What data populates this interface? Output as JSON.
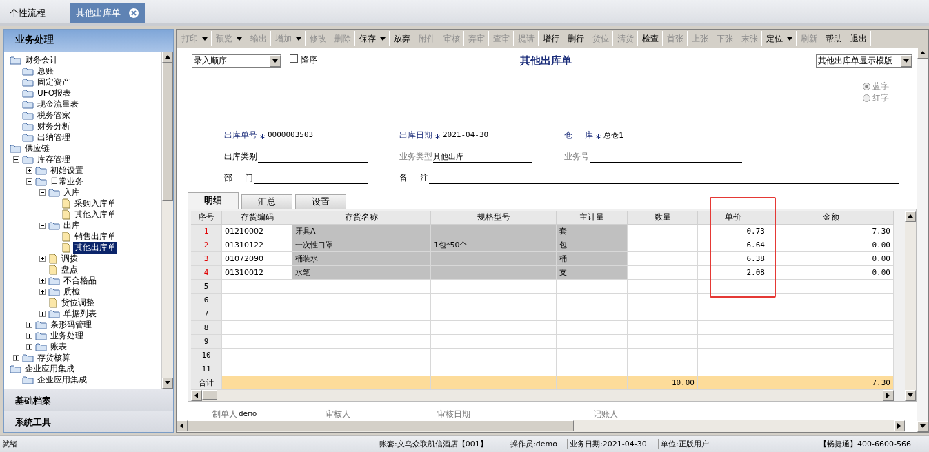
{
  "tabs": [
    {
      "label": "个性流程",
      "selected": false,
      "closable": false
    },
    {
      "label": "其他出库单",
      "selected": true,
      "closable": true
    }
  ],
  "nav": {
    "title": "业务处理",
    "tree": [
      {
        "label": "财务会计",
        "kind": "folder",
        "children": [
          {
            "label": "总账",
            "kind": "folder"
          },
          {
            "label": "固定资产",
            "kind": "folder"
          },
          {
            "label": "UFO报表",
            "kind": "folder"
          },
          {
            "label": "现金流量表",
            "kind": "folder"
          },
          {
            "label": "税务管家",
            "kind": "folder"
          },
          {
            "label": "财务分析",
            "kind": "folder"
          },
          {
            "label": "出纳管理",
            "kind": "folder"
          }
        ]
      },
      {
        "label": "供应链",
        "kind": "folder",
        "children": [
          {
            "label": "库存管理",
            "kind": "folder",
            "expanded": true,
            "children": [
              {
                "label": "初始设置",
                "kind": "folder",
                "expanded": false
              },
              {
                "label": "日常业务",
                "kind": "folder",
                "expanded": true,
                "children": [
                  {
                    "label": "入库",
                    "kind": "folder",
                    "expanded": true,
                    "children": [
                      {
                        "label": "采购入库单",
                        "kind": "document",
                        "selected": false
                      },
                      {
                        "label": "其他入库单",
                        "kind": "document",
                        "selected": false
                      }
                    ]
                  },
                  {
                    "label": "出库",
                    "kind": "folder",
                    "expanded": true,
                    "children": [
                      {
                        "label": "销售出库单",
                        "kind": "document",
                        "selected": false
                      },
                      {
                        "label": "其他出库单",
                        "kind": "document",
                        "selected": true
                      }
                    ]
                  },
                  {
                    "label": "调拨",
                    "kind": "document",
                    "expanded": false
                  },
                  {
                    "label": "盘点",
                    "kind": "document"
                  },
                  {
                    "label": "不合格品",
                    "kind": "folder",
                    "expanded": false
                  },
                  {
                    "label": "质检",
                    "kind": "folder",
                    "expanded": false
                  },
                  {
                    "label": "货位调整",
                    "kind": "document"
                  },
                  {
                    "label": "单据列表",
                    "kind": "folder",
                    "expanded": false
                  }
                ]
              },
              {
                "label": "条形码管理",
                "kind": "folder",
                "expanded": false
              },
              {
                "label": "业务处理",
                "kind": "folder",
                "expanded": false
              },
              {
                "label": "账表",
                "kind": "folder",
                "expanded": false
              }
            ]
          },
          {
            "label": "存货核算",
            "kind": "folder",
            "expanded": false
          }
        ]
      },
      {
        "label": "企业应用集成",
        "kind": "folder",
        "children": [
          {
            "label": "企业应用集成",
            "kind": "folder"
          }
        ]
      }
    ],
    "sections": [
      "基础档案",
      "系统工具"
    ]
  },
  "toolbar": [
    {
      "label": "打印",
      "disabled": true,
      "dropdown": true
    },
    {
      "label": "预览",
      "disabled": true,
      "dropdown": true
    },
    {
      "label": "输出",
      "disabled": true,
      "dropdown": false
    },
    {
      "label": "增加",
      "disabled": true,
      "dropdown": true
    },
    {
      "label": "修改",
      "disabled": true,
      "dropdown": false
    },
    {
      "label": "删除",
      "disabled": true,
      "dropdown": false
    },
    {
      "label": "保存",
      "disabled": false,
      "dropdown": true
    },
    {
      "label": "放弃",
      "disabled": false,
      "dropdown": false
    },
    {
      "label": "附件",
      "disabled": true,
      "dropdown": false
    },
    {
      "label": "审核",
      "disabled": true,
      "dropdown": false
    },
    {
      "label": "弃审",
      "disabled": true,
      "dropdown": false
    },
    {
      "label": "查审",
      "disabled": true,
      "dropdown": false
    },
    {
      "label": "提请",
      "disabled": true,
      "dropdown": false
    },
    {
      "label": "增行",
      "disabled": false,
      "dropdown": false
    },
    {
      "label": "删行",
      "disabled": false,
      "dropdown": false
    },
    {
      "label": "货位",
      "disabled": true,
      "dropdown": false
    },
    {
      "label": "清货",
      "disabled": true,
      "dropdown": false
    },
    {
      "label": "检查",
      "disabled": false,
      "dropdown": false
    },
    {
      "label": "首张",
      "disabled": true,
      "dropdown": false
    },
    {
      "label": "上张",
      "disabled": true,
      "dropdown": false
    },
    {
      "label": "下张",
      "disabled": true,
      "dropdown": false
    },
    {
      "label": "末张",
      "disabled": true,
      "dropdown": false
    },
    {
      "label": "定位",
      "disabled": false,
      "dropdown": true
    },
    {
      "label": "刷新",
      "disabled": true,
      "dropdown": false
    },
    {
      "label": "帮助",
      "disabled": false,
      "dropdown": false
    },
    {
      "label": "退出",
      "disabled": false,
      "dropdown": false
    }
  ],
  "form": {
    "sort_select": {
      "value": "录入顺序"
    },
    "descending": {
      "label": "降序",
      "checked": false
    },
    "title": "其他出库单",
    "template_select": {
      "value": "其他出库单显示模版"
    },
    "color_options": [
      {
        "label": "蓝字",
        "selected": true
      },
      {
        "label": "红字",
        "selected": false
      }
    ],
    "fields": [
      [
        {
          "label": "出库单号",
          "required": true,
          "disabled": false,
          "value": "0000003503"
        },
        {
          "label": "出库日期",
          "required": true,
          "disabled": false,
          "value": "2021-04-30"
        },
        {
          "label": "仓 库",
          "required": true,
          "disabled": false,
          "value": "总仓1"
        }
      ],
      [
        {
          "label": "出库类别",
          "required": false,
          "disabled": false
        },
        {
          "label": "业务类型",
          "required": false,
          "disabled": true,
          "value": "其他出库"
        },
        {
          "label": "业务号",
          "required": false,
          "disabled": true
        }
      ],
      [
        {
          "label": "部 门",
          "required": false,
          "disabled": false
        },
        {
          "label": "备 注",
          "required": false,
          "disabled": false
        }
      ]
    ],
    "detail_tabs": [
      {
        "label": "明细",
        "selected": true
      },
      {
        "label": "汇总",
        "selected": false
      },
      {
        "label": "设置",
        "selected": false
      }
    ],
    "table": {
      "columns": [
        {
          "label": "序号",
          "kind": "index"
        },
        {
          "label": "存货编码",
          "kind": "text"
        },
        {
          "label": "存货名称",
          "kind": "text",
          "readonly": true
        },
        {
          "label": "规格型号",
          "kind": "text",
          "readonly": true
        },
        {
          "label": "主计量",
          "kind": "text",
          "readonly": true
        },
        {
          "label": "数量",
          "kind": "number",
          "total": "10.00"
        },
        {
          "label": "单价",
          "kind": "number",
          "highlighted": true
        },
        {
          "label": "金额",
          "kind": "number",
          "total": "7.30"
        }
      ],
      "rows": [
        {
          "filled": true,
          "cells": [
            "1",
            "01210002",
            "牙具A",
            null,
            "套",
            null,
            "0.73",
            "7.30"
          ]
        },
        {
          "filled": true,
          "cells": [
            "2",
            "01310122",
            "一次性口罩",
            "1包*50个",
            "包",
            null,
            "6.64",
            "0.00"
          ]
        },
        {
          "filled": true,
          "cells": [
            "3",
            "01072090",
            "桶装水",
            null,
            "桶",
            null,
            "6.38",
            "0.00"
          ]
        },
        {
          "filled": true,
          "cells": [
            "4",
            "01310012",
            "水笔",
            null,
            "支",
            null,
            "2.08",
            "0.00"
          ]
        },
        {
          "filled": false,
          "cells": [
            "5"
          ]
        },
        {
          "filled": false,
          "cells": [
            "6"
          ]
        },
        {
          "filled": false,
          "cells": [
            "7"
          ]
        },
        {
          "filled": false,
          "cells": [
            "8"
          ]
        },
        {
          "filled": false,
          "cells": [
            "9"
          ]
        },
        {
          "filled": false,
          "cells": [
            "10"
          ]
        },
        {
          "filled": false,
          "cells": [
            "11"
          ]
        }
      ],
      "total_label": "合计"
    },
    "signatures": [
      {
        "label": "制单人",
        "value": "demo"
      },
      {
        "label": "审核人"
      },
      {
        "label": "审核日期"
      },
      {
        "label": "记账人"
      }
    ]
  },
  "status_bar": [
    "就绪",
    "账套:义乌众联凯信酒店【001】",
    "操作员:demo",
    "业务日期:2021-04-30",
    "单位:正版用户",
    "【畅捷通】400-6600-566"
  ]
}
